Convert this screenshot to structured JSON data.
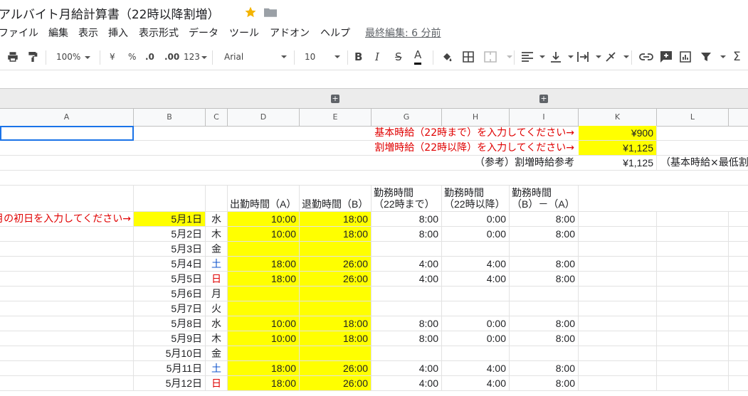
{
  "title": "アルバイト月給計算書（22時以降割増）",
  "menu": [
    "ファイル",
    "編集",
    "表示",
    "挿入",
    "表示形式",
    "データ",
    "ツール",
    "アドオン",
    "ヘルプ"
  ],
  "last_edit": "最終編集: 6 分前",
  "toolbar": {
    "zoom": "100%",
    "currency": "¥",
    "percent": "%",
    "dec_less": ".0",
    "dec_more": ".00",
    "format": "123",
    "font": "Arial",
    "size": "10",
    "bold": "B",
    "italic": "I",
    "strike": "S",
    "text_color": "A"
  },
  "columns": [
    "A",
    "B",
    "C",
    "D",
    "E",
    "G",
    "H",
    "I",
    "K",
    "L"
  ],
  "group_buttons": [
    "+",
    "+"
  ],
  "info": {
    "base_label": "基本時給（22時まで）を入力してください→",
    "base_value": "¥900",
    "extra_label": "割増時給（22時以降）を入力してください→",
    "extra_value": "¥1,125",
    "ref_label": "（参考）割増時給参考",
    "ref_value": "¥1,125",
    "ref_note": "（基本時給×最低割増"
  },
  "headers": {
    "start": "出勤時間（A）",
    "end": "退勤時間（B）",
    "before22_1": "勤務時間",
    "before22_2": "（22時まで）",
    "after22_1": "勤務時間",
    "after22_2": "（22時以降）",
    "total_1": "勤務時間",
    "total_2": "（B）－（A）"
  },
  "month_prompt": "月の初日を入力してください→",
  "rows": [
    {
      "date": "5月1日",
      "dow": "水",
      "dow_color": "black",
      "start": "10:00",
      "end": "18:00",
      "g": "8:00",
      "h": "0:00",
      "i": "8:00"
    },
    {
      "date": "5月2日",
      "dow": "木",
      "dow_color": "black",
      "start": "10:00",
      "end": "18:00",
      "g": "8:00",
      "h": "0:00",
      "i": "8:00"
    },
    {
      "date": "5月3日",
      "dow": "金",
      "dow_color": "black",
      "start": "",
      "end": "",
      "g": "",
      "h": "",
      "i": ""
    },
    {
      "date": "5月4日",
      "dow": "土",
      "dow_color": "blue",
      "start": "18:00",
      "end": "26:00",
      "g": "4:00",
      "h": "4:00",
      "i": "8:00"
    },
    {
      "date": "5月5日",
      "dow": "日",
      "dow_color": "red",
      "start": "18:00",
      "end": "26:00",
      "g": "4:00",
      "h": "4:00",
      "i": "8:00"
    },
    {
      "date": "5月6日",
      "dow": "月",
      "dow_color": "black",
      "start": "",
      "end": "",
      "g": "",
      "h": "",
      "i": ""
    },
    {
      "date": "5月7日",
      "dow": "火",
      "dow_color": "black",
      "start": "",
      "end": "",
      "g": "",
      "h": "",
      "i": ""
    },
    {
      "date": "5月8日",
      "dow": "水",
      "dow_color": "black",
      "start": "10:00",
      "end": "18:00",
      "g": "8:00",
      "h": "0:00",
      "i": "8:00"
    },
    {
      "date": "5月9日",
      "dow": "木",
      "dow_color": "black",
      "start": "10:00",
      "end": "18:00",
      "g": "8:00",
      "h": "0:00",
      "i": "8:00"
    },
    {
      "date": "5月10日",
      "dow": "金",
      "dow_color": "black",
      "start": "",
      "end": "",
      "g": "",
      "h": "",
      "i": ""
    },
    {
      "date": "5月11日",
      "dow": "土",
      "dow_color": "blue",
      "start": "18:00",
      "end": "26:00",
      "g": "4:00",
      "h": "4:00",
      "i": "8:00"
    },
    {
      "date": "5月12日",
      "dow": "日",
      "dow_color": "red",
      "start": "18:00",
      "end": "26:00",
      "g": "4:00",
      "h": "4:00",
      "i": "8:00"
    }
  ]
}
